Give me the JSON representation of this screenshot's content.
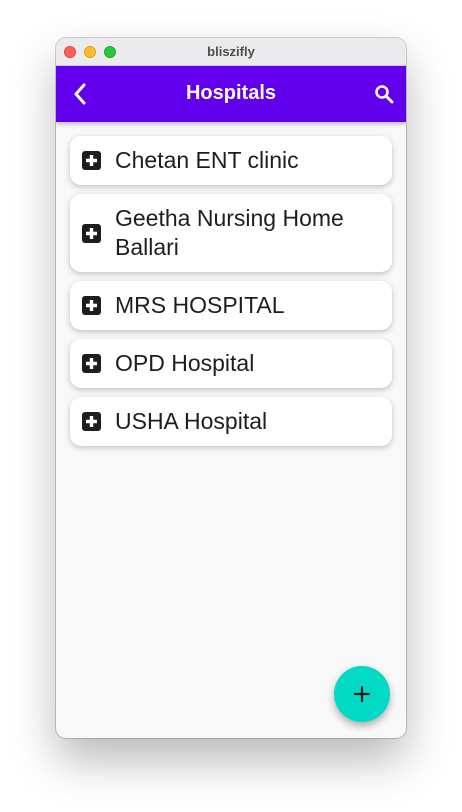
{
  "window": {
    "title": "bliszifly"
  },
  "appbar": {
    "title": "Hospitals",
    "back_icon": "chevron-left-icon",
    "search_icon": "search-icon"
  },
  "hospitals": [
    {
      "name": "Chetan ENT clinic",
      "icon": "hospital-icon"
    },
    {
      "name": "Geetha Nursing Home Ballari",
      "icon": "hospital-icon"
    },
    {
      "name": "MRS HOSPITAL",
      "icon": "hospital-icon"
    },
    {
      "name": "OPD Hospital",
      "icon": "hospital-icon"
    },
    {
      "name": "USHA Hospital",
      "icon": "hospital-icon"
    }
  ],
  "fab": {
    "icon": "plus-icon"
  },
  "colors": {
    "appbar": "#6200ee",
    "fab": "#03dac6",
    "background": "#f8f8f9",
    "card": "#ffffff"
  }
}
